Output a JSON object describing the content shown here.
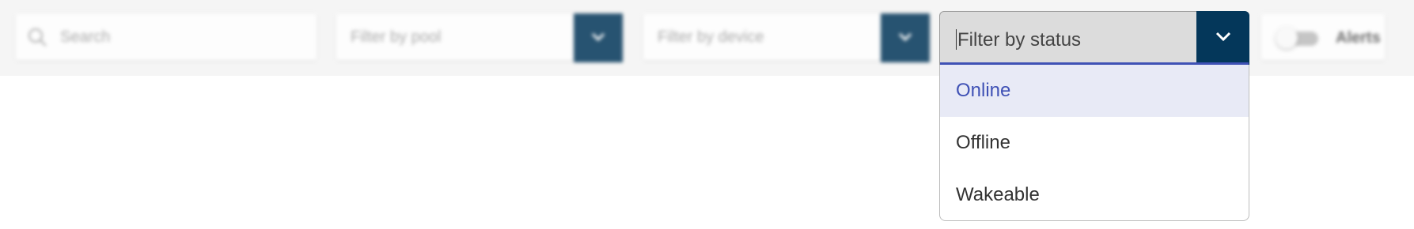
{
  "filters": {
    "search_placeholder": "Search",
    "pool_placeholder": "Filter by pool",
    "device_placeholder": "Filter by device",
    "status_placeholder": "Filter by status",
    "alerts_label": "Alerts",
    "alerts_on": false
  },
  "status_menu": {
    "options": [
      {
        "label": "Online",
        "highlighted": true
      },
      {
        "label": "Offline",
        "highlighted": false
      },
      {
        "label": "Wakeable",
        "highlighted": false
      }
    ]
  },
  "colors": {
    "dropdown_button": "#04375a",
    "accent": "#3f51b5",
    "highlight_bg": "#e8eaf6"
  },
  "icons": {
    "search": "search-icon",
    "dropdown": "chevron-down-icon"
  }
}
